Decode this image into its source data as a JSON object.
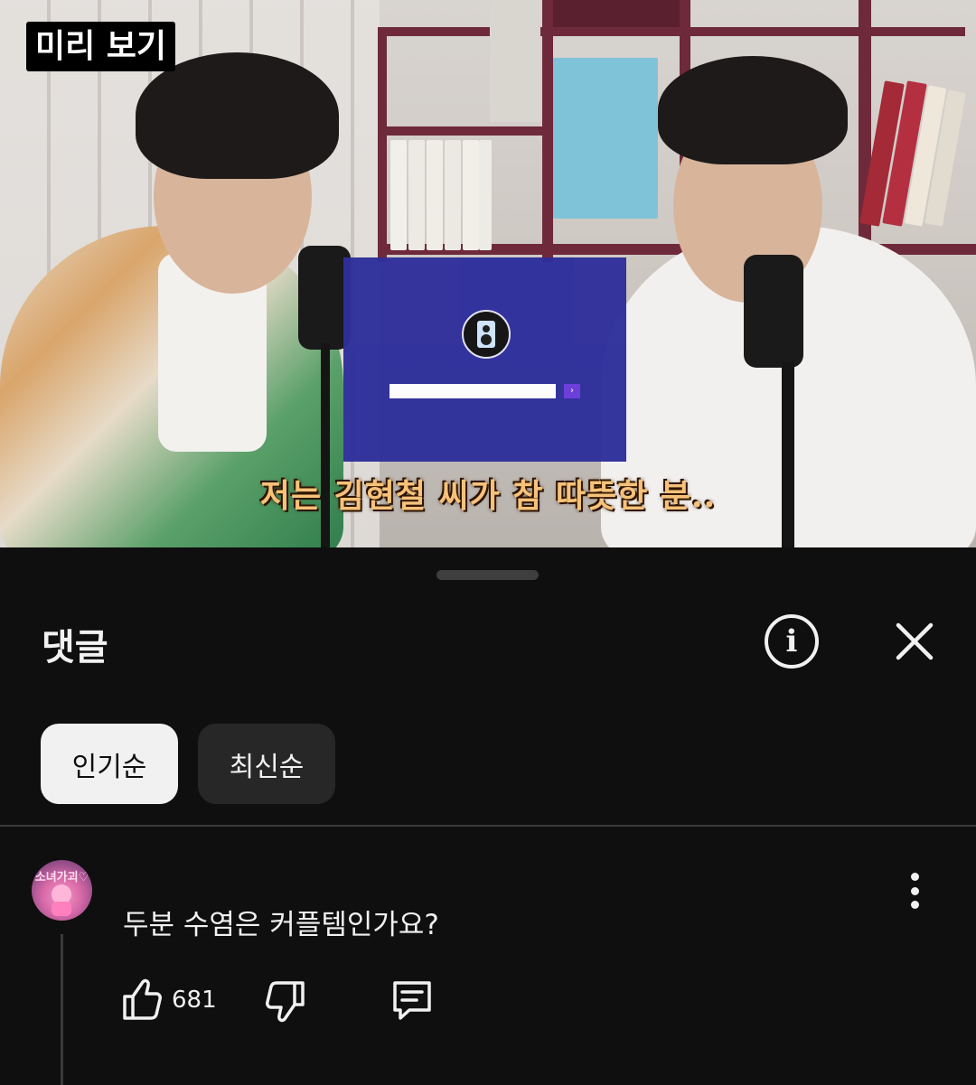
{
  "video": {
    "preview_badge": "미리 보기",
    "subtitle": "저는 김현철 씨가 참 따뜻한 분..",
    "overlay_go": "›"
  },
  "comments_sheet": {
    "title": "댓글",
    "sort_chips": [
      {
        "label": "인기순",
        "selected": true
      },
      {
        "label": "최신순",
        "selected": false
      }
    ],
    "icons": {
      "info": "info-icon",
      "close": "close-icon"
    }
  },
  "comment": {
    "avatar_text": "소녀가괴♡",
    "text": "두분 수염은 커플템인가요?",
    "like_count": "681"
  },
  "colors": {
    "background": "#0f0f0f",
    "chip_selected_bg": "#f1f1f1",
    "chip_unselected_bg": "#272727",
    "overlay_box": "#2f2f9c",
    "subtitle_color": "#f6c27a"
  }
}
